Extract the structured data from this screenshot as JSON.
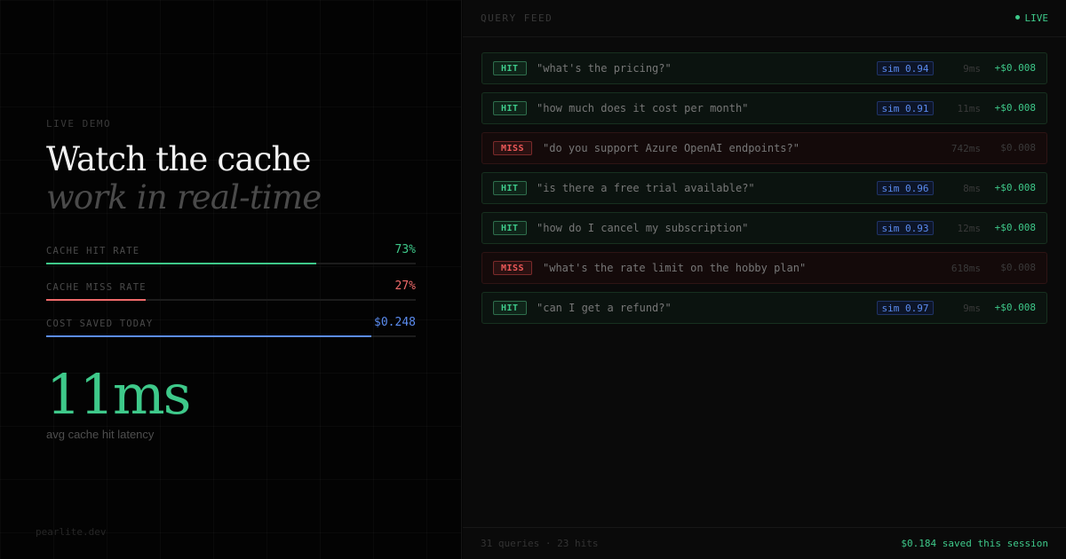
{
  "hero": {
    "eyebrow": "LIVE DEMO",
    "title_line1": "Watch the cache",
    "title_line2": "work in real-time"
  },
  "metrics": [
    {
      "label": "CACHE HIT RATE",
      "value": "73%",
      "fill_fraction": 0.73,
      "color": "#3ec98a"
    },
    {
      "label": "CACHE MISS RATE",
      "value": "27%",
      "fill_fraction": 0.27,
      "color": "#ef6a6a"
    },
    {
      "label": "COST SAVED TODAY",
      "value": "$0.248",
      "fill_fraction": 0.88,
      "color": "#5b8cf0"
    }
  ],
  "latency": {
    "value": "11ms",
    "label": "avg cache hit latency"
  },
  "brand": "pearlite.dev",
  "feed": {
    "title": "QUERY FEED",
    "live_label": "LIVE",
    "rows": [
      {
        "status": "hit",
        "badge": "HIT",
        "query": "\"what's the pricing?\"",
        "sim": "sim 0.94",
        "latency": "9ms",
        "saved": "+$0.008"
      },
      {
        "status": "hit",
        "badge": "HIT",
        "query": "\"how much does it cost per month\"",
        "sim": "sim 0.91",
        "latency": "11ms",
        "saved": "+$0.008"
      },
      {
        "status": "miss",
        "badge": "MISS",
        "query": "\"do you support Azure OpenAI endpoints?\"",
        "sim": "",
        "latency": "742ms",
        "saved": "$0.008"
      },
      {
        "status": "hit",
        "badge": "HIT",
        "query": "\"is there a free trial available?\"",
        "sim": "sim 0.96",
        "latency": "8ms",
        "saved": "+$0.008"
      },
      {
        "status": "hit",
        "badge": "HIT",
        "query": "\"how do I cancel my subscription\"",
        "sim": "sim 0.93",
        "latency": "12ms",
        "saved": "+$0.008"
      },
      {
        "status": "miss",
        "badge": "MISS",
        "query": "\"what's the rate limit on the hobby plan\"",
        "sim": "",
        "latency": "618ms",
        "saved": "$0.008"
      },
      {
        "status": "hit",
        "badge": "HIT",
        "query": "\"can I get a refund?\"",
        "sim": "sim 0.97",
        "latency": "9ms",
        "saved": "+$0.008"
      }
    ],
    "footer_stats": "31 queries · 23 hits",
    "footer_saved": "$0.184 saved this session"
  },
  "colors": {
    "hit": "#3ec98a",
    "miss": "#ef5959",
    "similarity": "#5b8cf0"
  }
}
